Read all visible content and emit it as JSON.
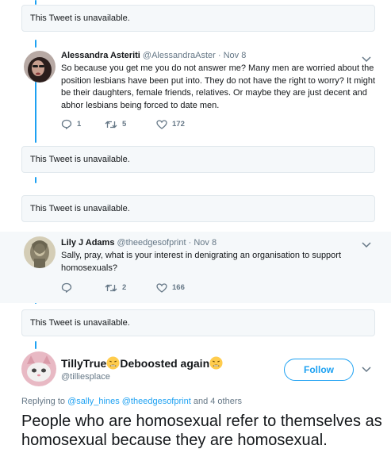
{
  "unavailable_text": "This Tweet is unavailable.",
  "tweet1": {
    "name": "Alessandra Asteriti",
    "handle": "@AlessandraAster",
    "separator": "·",
    "date": "Nov 8",
    "text": "So because you get me you do not answer me? Many men are worried about the position lesbians have been put into. They do not have the right to worry? It might be their daughters, female friends, relatives. Or maybe they are just decent and abhor lesbians being forced to date men.",
    "replies": "1",
    "retweets": "5",
    "likes": "172"
  },
  "tweet2": {
    "name": "Lily J Adams",
    "handle": "@theedgesofprint",
    "separator": "·",
    "date": "Nov 8",
    "text": "Sally, pray, what is your interest in denigrating an organisation to support homosexuals?",
    "retweets": "2",
    "likes": "166"
  },
  "main_tweet": {
    "name_part1": "TillyTrue",
    "name_part2": "Deboosted again",
    "handle": "@tilliesplace",
    "follow_label": "Follow",
    "replying_prefix": "Replying to",
    "replying_user1": "@sally_hines",
    "replying_user2": "@theedgesofprint",
    "replying_suffix": "and 4 others",
    "text": "People who are homosexual refer to themselves as homosexual because they are homosexual."
  },
  "colors": {
    "accent": "#1da1f2",
    "secondary_text": "#657786",
    "border": "#e1e8ed",
    "grey_bg": "#f5f8fa"
  }
}
